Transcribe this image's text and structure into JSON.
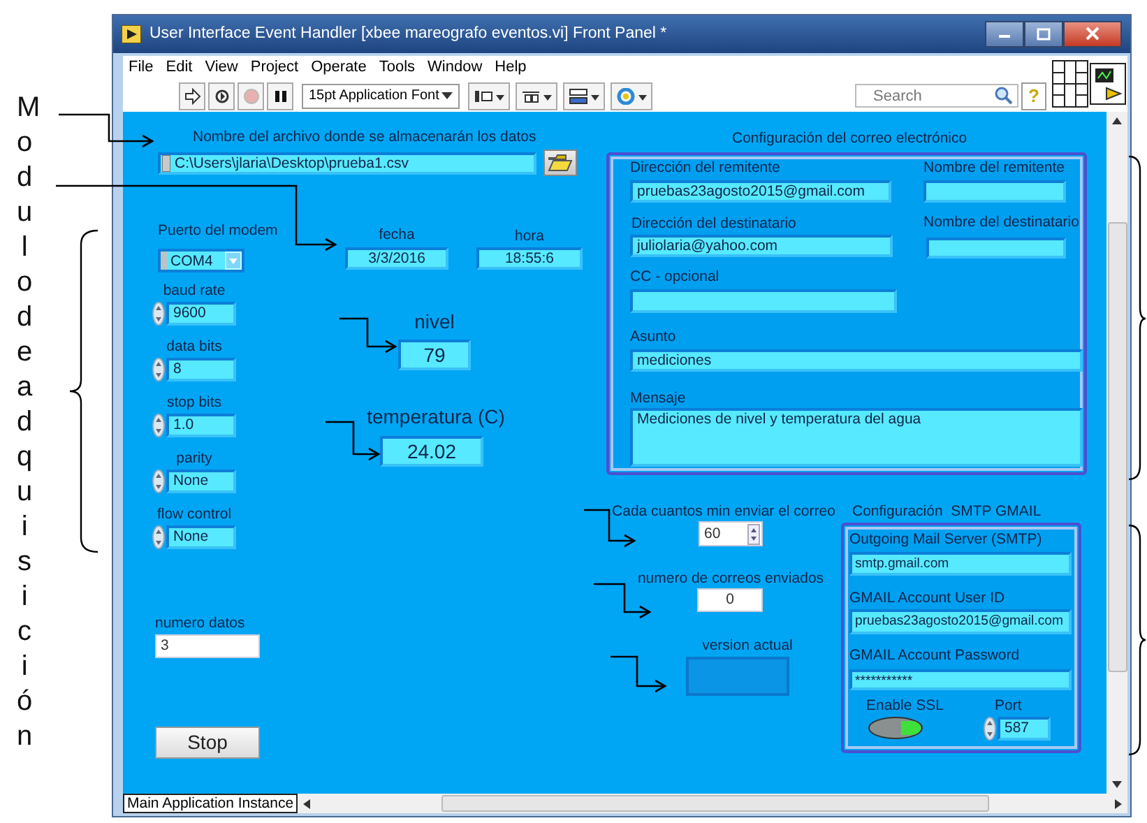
{
  "annotation": {
    "text": "Modulodeadquisición"
  },
  "window": {
    "title": "User Interface Event Handler [xbee mareografo eventos.vi] Front Panel *"
  },
  "menu": [
    "File",
    "Edit",
    "View",
    "Project",
    "Operate",
    "Tools",
    "Window",
    "Help"
  ],
  "toolbar": {
    "font": "15pt Application Font",
    "search": {
      "placeholder": "Search"
    },
    "help": "?"
  },
  "panel": {
    "file": {
      "label": "Nombre del archivo donde se almacenarán los datos",
      "value": "C:\\Users\\jlaria\\Desktop\\prueba1.csv"
    },
    "modem": {
      "label": "Puerto del modem",
      "value": "COM4"
    },
    "serial": [
      {
        "label": "baud rate",
        "value": "9600"
      },
      {
        "label": "data bits",
        "value": "8"
      },
      {
        "label": "stop bits",
        "value": "1.0"
      },
      {
        "label": "parity",
        "value": "None"
      },
      {
        "label": "flow control",
        "value": "None"
      }
    ],
    "fecha": {
      "label": "fecha",
      "value": "3/3/2016"
    },
    "hora": {
      "label": "hora",
      "value": "18:55:6"
    },
    "nivel": {
      "label": "nivel",
      "value": "79"
    },
    "temperatura": {
      "label": "temperatura (C)",
      "value": "24.02"
    },
    "numero_datos": {
      "label": "numero datos",
      "value": "3"
    },
    "stop": "Stop",
    "intervalo": {
      "label": "Cada cuantos min enviar el correo",
      "value": "60"
    },
    "correos_enviados": {
      "label": "numero de correos enviados",
      "value": "0"
    },
    "version": {
      "label": "version actual"
    },
    "email": {
      "title": "Configuración del correo electrónico",
      "fields": [
        {
          "label": "Dirección del remitente",
          "value": "pruebas23agosto2015@gmail.com"
        },
        {
          "label": "Nombre del remitente"
        },
        {
          "label": "Dirección del destinatario",
          "value": "juliolaria@yahoo.com"
        },
        {
          "label": "Nombre del destinatario"
        },
        {
          "label": "CC - opcional"
        },
        {
          "label": "Asunto",
          "value": "mediciones"
        },
        {
          "label": "Mensaje",
          "value": "Mediciones de nivel y temperatura del agua"
        }
      ]
    },
    "smtp": {
      "title": "Configuración  SMTP GMAIL",
      "fields": [
        {
          "label": "Outgoing Mail Server (SMTP)",
          "value": "smtp.gmail.com"
        },
        {
          "label": "GMAIL Account User ID",
          "value": "pruebas23agosto2015@gmail.com"
        },
        {
          "label": "GMAIL Account Password",
          "value": "***********"
        }
      ],
      "ssl": {
        "label": "Enable SSL",
        "on": true
      },
      "port": {
        "label": "Port",
        "value": "587"
      }
    }
  },
  "status_bar": "Main Application Instance"
}
